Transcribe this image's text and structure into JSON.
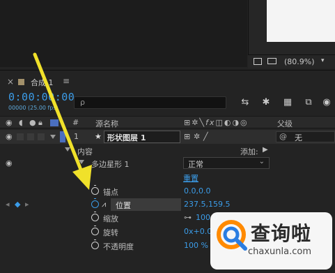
{
  "viewer": {
    "zoom": "(80.9%)"
  },
  "panel": {
    "close": "×",
    "title": "合成 1",
    "menu": "≡"
  },
  "timecode": {
    "value": "0:00:00:00",
    "sub": "00000 (25.00 fps)"
  },
  "search": {
    "icon": "ρ"
  },
  "columns": {
    "num": "#",
    "source_name": "源名称",
    "parent": "父级"
  },
  "layer": {
    "num": "1",
    "name": "形状图层 1",
    "parent": "无"
  },
  "contents": {
    "label": "内容",
    "add": "添加:"
  },
  "polystar": {
    "label": "多边星形 1",
    "mode": "正常",
    "reset": "重置"
  },
  "properties": [
    {
      "label": "锚点",
      "value": "0.0,0.0"
    },
    {
      "label": "位置",
      "value": "237.5,159.5"
    },
    {
      "label": "缩放",
      "value": "100.0"
    },
    {
      "label": "旋转",
      "value": "0x+0.0"
    },
    {
      "label": "不透明度",
      "value": "100 %"
    }
  ],
  "watermark": {
    "name": "查询啦",
    "url": "chaxunla.com"
  },
  "colors": {
    "accent": "#3b9ce8",
    "arrow": "#f0e12a"
  }
}
